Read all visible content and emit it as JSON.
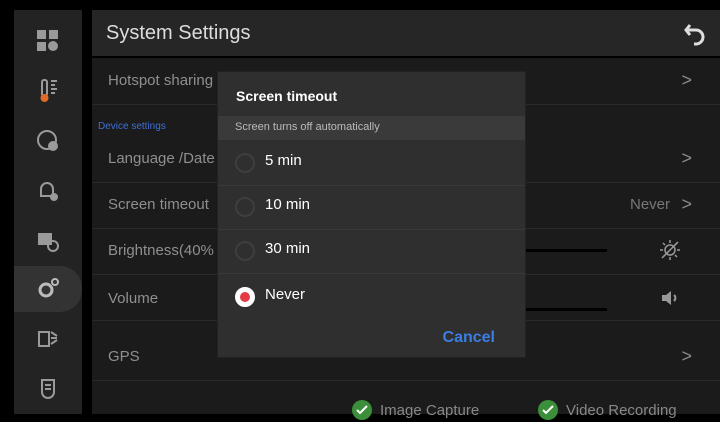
{
  "header": {
    "title": "System Settings"
  },
  "settings": {
    "hotspot": "Hotspot sharing",
    "section": "Device settings",
    "language": "Language /Date",
    "screen_timeout": "Screen timeout",
    "screen_timeout_value": "Never",
    "brightness": "Brightness(40%",
    "volume": "Volume",
    "gps": "GPS",
    "chevron": ">"
  },
  "dialog": {
    "title": "Screen timeout",
    "subtitle": "Screen turns off automatically",
    "options": [
      {
        "label": "5 min",
        "selected": false
      },
      {
        "label": "10 min",
        "selected": false
      },
      {
        "label": "30 min",
        "selected": false
      },
      {
        "label": "Never",
        "selected": true
      }
    ],
    "cancel": "Cancel"
  },
  "status": {
    "image": "Image Capture",
    "video": "Video Recording"
  },
  "sidebar_icons": [
    "dashboard-icon",
    "temperature-icon",
    "settings-profile-icon",
    "alert-settings-icon",
    "camera-settings-icon",
    "system-gear-icon",
    "image-filter-icon",
    "report-icon"
  ],
  "colors": {
    "accent_blue": "#3a7ee4",
    "selected_red": "#e43b45",
    "status_green": "#3b8f3a"
  }
}
